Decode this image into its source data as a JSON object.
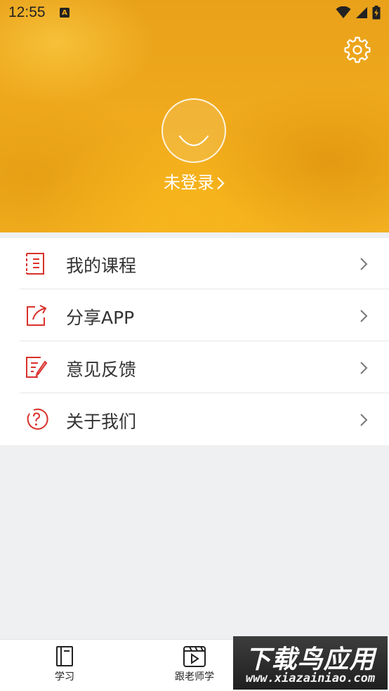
{
  "status_bar": {
    "time": "12:55",
    "notification_badge": "A",
    "icons": [
      "wifi-icon",
      "signal-icon",
      "battery-charging-icon"
    ]
  },
  "profile": {
    "login_text": "未登录"
  },
  "menu": {
    "items": [
      {
        "label": "我的课程",
        "icon": "course-list-icon"
      },
      {
        "label": "分享APP",
        "icon": "share-icon"
      },
      {
        "label": "意见反馈",
        "icon": "feedback-icon"
      },
      {
        "label": "关于我们",
        "icon": "question-icon"
      }
    ]
  },
  "bottom_nav": {
    "tabs": [
      {
        "label": "学习",
        "icon": "book-icon"
      },
      {
        "label": "跟老师学",
        "icon": "video-play-icon"
      }
    ]
  },
  "watermark": {
    "title": "下载鸟应用",
    "url": "www.xiazainiao.com"
  },
  "colors": {
    "header": "#f0aa1c",
    "accent_red": "#d9312b",
    "background": "#eef0f2"
  }
}
